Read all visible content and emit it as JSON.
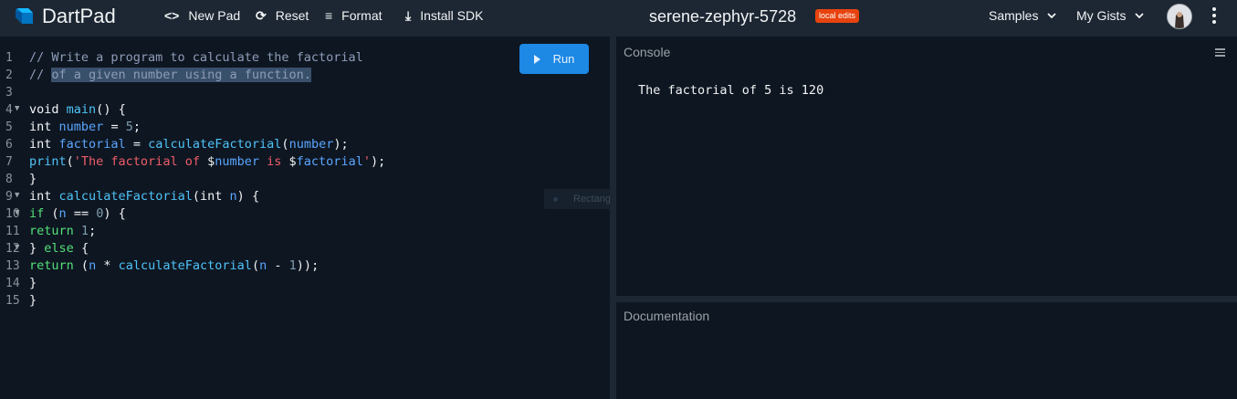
{
  "header": {
    "brand": "DartPad",
    "new_pad": "New Pad",
    "reset": "Reset",
    "format": "Format",
    "install_sdk": "Install SDK",
    "pad_name": "serene-zephyr-5728",
    "badge": "local edits",
    "samples": "Samples",
    "my_gists": "My Gists"
  },
  "editor": {
    "run_label": "Run",
    "line_numbers": [
      "1",
      "2",
      "3",
      "4",
      "5",
      "6",
      "7",
      "8",
      "9",
      "10",
      "11",
      "12",
      "13",
      "14",
      "15"
    ],
    "folded_lines": [
      4,
      9,
      10,
      12
    ],
    "code": [
      "// Write a program to calculate the factorial",
      "// of a given number using a function.",
      "",
      "void main() {",
      "int number = 5;",
      "int factorial = calculateFactorial(number);",
      "print('The factorial of $number is $factorial');",
      "}",
      "int calculateFactorial(int n) {",
      "if (n == 0) {",
      "return 1;",
      "} else {",
      "return (n * calculateFactorial(n - 1));",
      "}",
      "}"
    ]
  },
  "overlay": {
    "snip_label": "Rectangular Snip"
  },
  "console": {
    "title": "Console",
    "output": "The factorial of 5 is 120"
  },
  "documentation": {
    "title": "Documentation"
  },
  "colors": {
    "accent": "#1e88e5",
    "badge": "#e8430f",
    "background": "#0e1621",
    "toolbar": "#1d2733"
  },
  "icons": {
    "logo": "dart-logo-icon",
    "new_pad": "code-brackets-icon",
    "reset": "refresh-icon",
    "format": "format-lines-icon",
    "install_sdk": "download-icon",
    "dropdown": "chevron-down-icon",
    "more": "more-vert-icon",
    "run": "play-icon",
    "clear": "clear-console-icon"
  }
}
